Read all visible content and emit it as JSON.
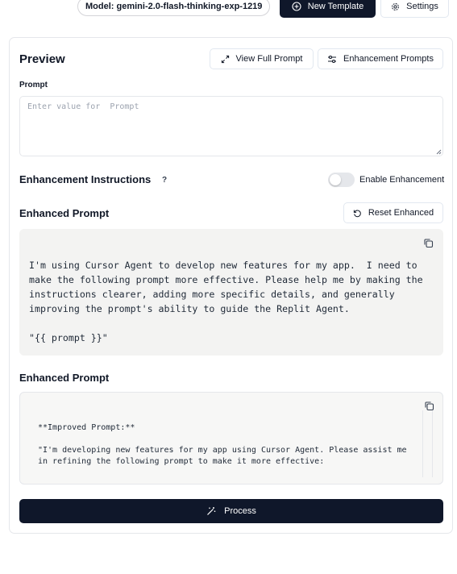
{
  "topbar": {
    "model_label": "Model: gemini-2.0-flash-thinking-exp-1219",
    "new_template_label": "New Template",
    "settings_label": "Settings"
  },
  "preview": {
    "title": "Preview",
    "view_full_prompt_label": "View Full Prompt",
    "enhancement_prompts_label": "Enhancement Prompts",
    "prompt_label": "Prompt",
    "prompt_placeholder": "Enter value for  Prompt",
    "prompt_value": ""
  },
  "instructions": {
    "title": "Enhancement Instructions",
    "help_mark": "?",
    "toggle_label": "Enable Enhancement",
    "toggle_on": false
  },
  "enhanced_template": {
    "title": "Enhanced Prompt",
    "reset_label": "Reset Enhanced",
    "text": "I'm using Cursor Agent to develop new features for my app.  I need to make the following prompt more effective. Please help me by making the instructions clearer, adding more specific details, and generally improving the prompt's ability to guide the Replit Agent.\n\n\"{{ prompt }}\""
  },
  "enhanced_result": {
    "title": "Enhanced Prompt",
    "text": "**Improved Prompt:**\n\n\"I'm developing new features for my app using Cursor Agent. Please assist me in refining the following prompt to make it more effective:"
  },
  "process_label": "Process",
  "icons": {
    "new_template": "plus-circle-icon",
    "settings": "gear-icon",
    "view_full_prompt": "expand-icon",
    "enhancement_prompts": "sliders-icon",
    "reset": "rotate-ccw-icon",
    "copy": "copy-icon",
    "process": "magic-wand-icon"
  },
  "colors": {
    "primary_dark": "#0f172a",
    "code_bg": "#f3f3f2",
    "border": "#e5e7eb"
  }
}
